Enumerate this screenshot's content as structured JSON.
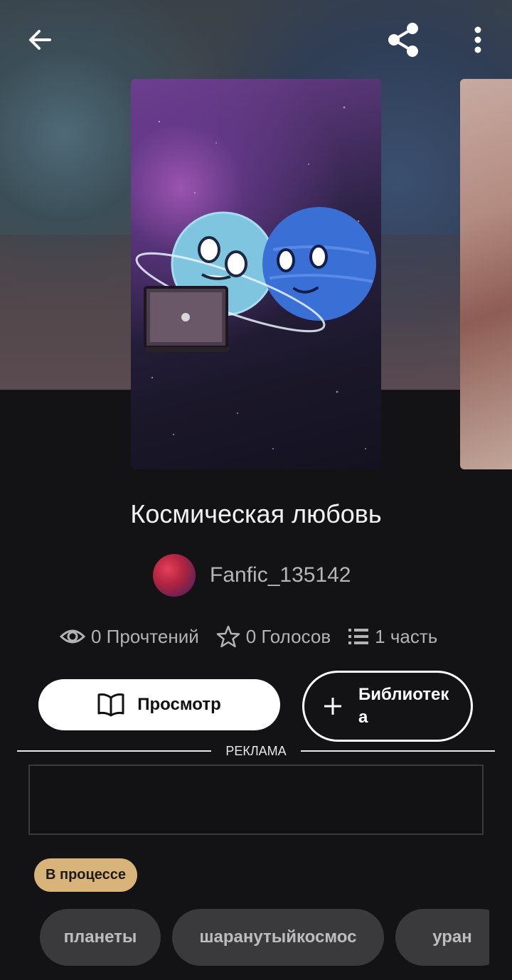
{
  "book": {
    "title": "Космическая любовь",
    "author": "Fanfic_135142",
    "stats": {
      "reads": "0 Прочтений",
      "votes": "0 Голосов",
      "parts": "1 часть"
    },
    "status": "В процессе",
    "tags": [
      "планеты",
      "шаранутыйкосмос",
      "уран"
    ]
  },
  "actions": {
    "view_label": "Просмотр",
    "library_label": "Библиотека"
  },
  "ad": {
    "label": "РЕКЛАМА"
  },
  "icons": {
    "back": "arrow-left-icon",
    "share": "share-icon",
    "more": "more-vertical-icon",
    "reads": "eye-icon",
    "votes": "star-icon",
    "parts": "list-icon",
    "view": "book-open-icon",
    "library": "plus-icon"
  },
  "colors": {
    "background": "#131214",
    "status_badge": "#d9b47a",
    "tag_bg": "#3a3a3d"
  }
}
